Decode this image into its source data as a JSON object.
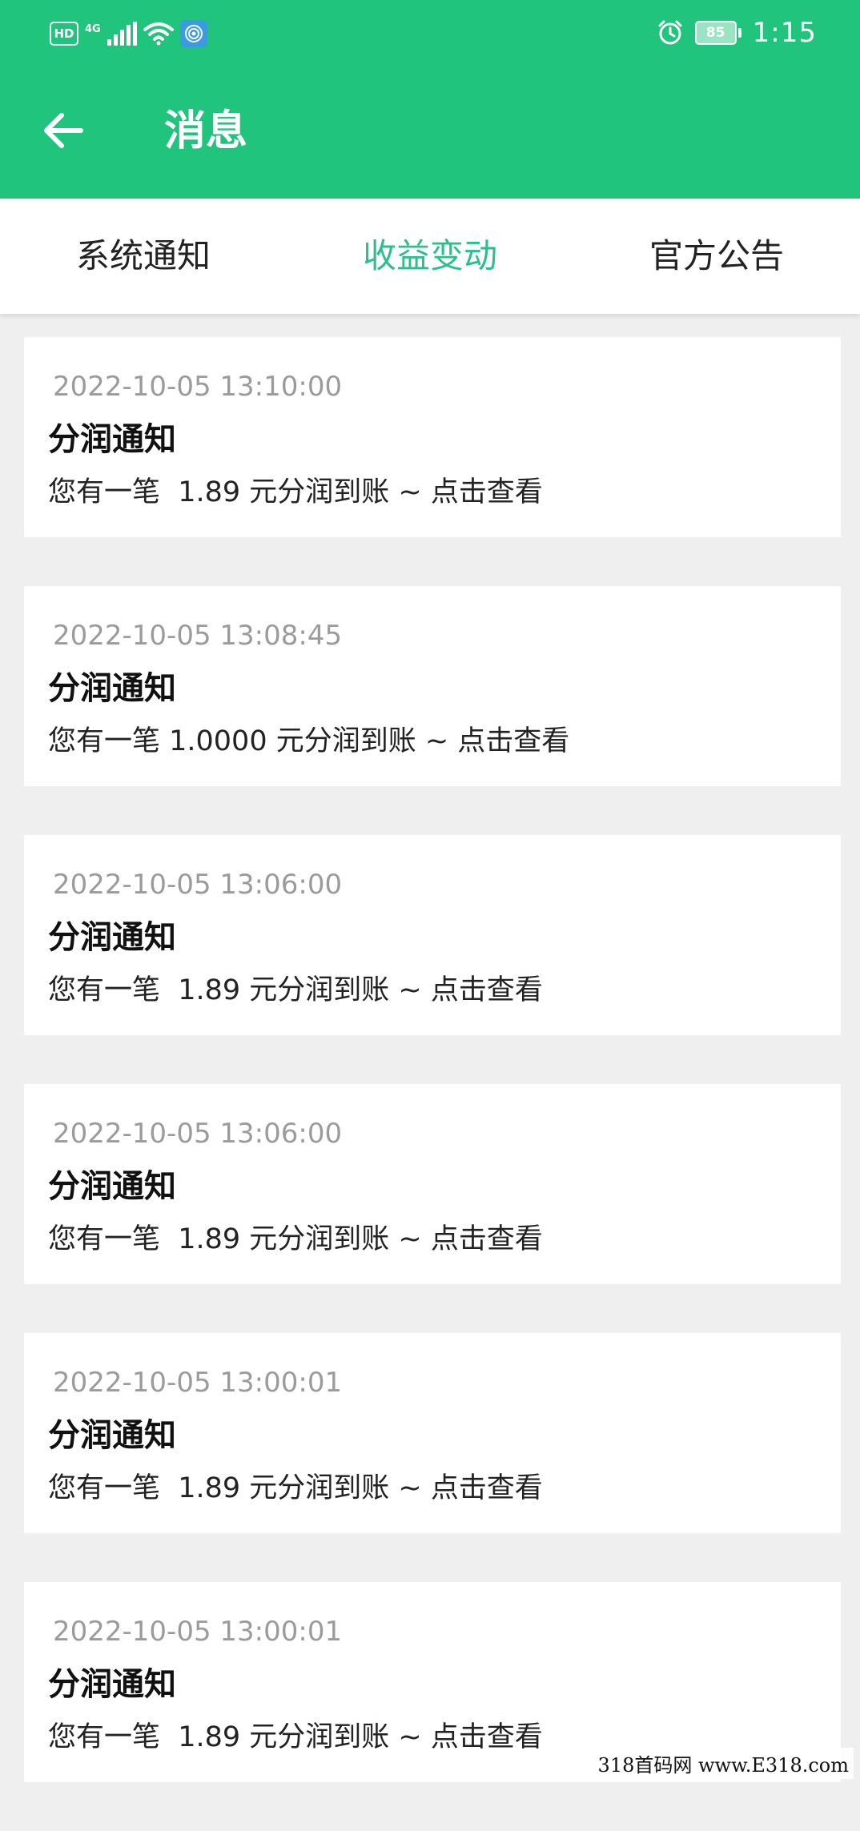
{
  "status_bar": {
    "hd": "HD",
    "network": "4G",
    "battery": "85",
    "time": "1:15",
    "icons": [
      "hd-icon",
      "signal-icon",
      "wifi-icon",
      "vpn-icon",
      "alarm-icon",
      "battery-icon"
    ]
  },
  "app_bar": {
    "title": "消息",
    "back_icon": "arrow-left-icon"
  },
  "tabs": [
    {
      "label": "系统通知",
      "active": false
    },
    {
      "label": "收益变动",
      "active": true
    },
    {
      "label": "官方公告",
      "active": false
    }
  ],
  "colors": {
    "primary": "#20c47c",
    "tab_active": "#2bbf8a",
    "tab_inactive": "#222222",
    "background": "#efefef"
  },
  "messages": [
    {
      "time": "2022-10-05 13:10:00",
      "title": "分润通知",
      "body": "您有一笔  1.89 元分润到账 ~ 点击查看"
    },
    {
      "time": "2022-10-05 13:08:45",
      "title": "分润通知",
      "body": "您有一笔 1.0000 元分润到账 ~ 点击查看"
    },
    {
      "time": "2022-10-05 13:06:00",
      "title": "分润通知",
      "body": "您有一笔  1.89 元分润到账 ~ 点击查看"
    },
    {
      "time": "2022-10-05 13:06:00",
      "title": "分润通知",
      "body": "您有一笔  1.89 元分润到账 ~ 点击查看"
    },
    {
      "time": "2022-10-05 13:00:01",
      "title": "分润通知",
      "body": "您有一笔  1.89 元分润到账 ~ 点击查看"
    },
    {
      "time": "2022-10-05 13:00:01",
      "title": "分润通知",
      "body": "您有一笔  1.89 元分润到账 ~ 点击查看"
    }
  ],
  "watermark": "318首码网  www.E318.com"
}
